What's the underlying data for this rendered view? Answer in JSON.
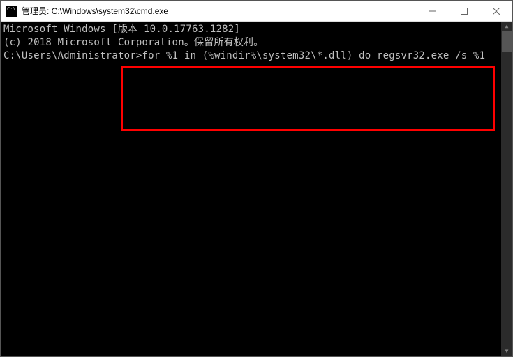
{
  "title_bar": {
    "text": "管理员: C:\\Windows\\system32\\cmd.exe"
  },
  "terminal": {
    "line1": "Microsoft Windows [版本 10.0.17763.1282]",
    "line2": "(c) 2018 Microsoft Corporation。保留所有权利。",
    "line3": "",
    "prompt": "C:\\Users\\Administrator>",
    "command": "for %1 in (%windir%\\system32\\*.dll) do regsvr32.exe /s %1"
  }
}
